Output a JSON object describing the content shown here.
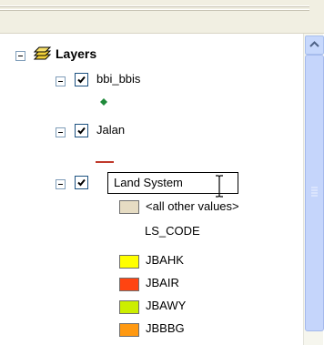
{
  "colors": {
    "point_symbol": "#1f8a3a",
    "line_symbol": "#c0392b",
    "all_other_values": "#e6dcc3",
    "JBAHK": "#ffff00",
    "JBAIR": "#ff4411",
    "JBAWY": "#ccee00",
    "JBBBG": "#ff9911"
  },
  "toc": {
    "root": {
      "label": "Layers",
      "icon": "layers-icon"
    },
    "layers": [
      {
        "label": "bbi_bbis",
        "checked": true,
        "symbol": "point"
      },
      {
        "label": "Jalan",
        "checked": true,
        "symbol": "line"
      },
      {
        "label": "Land System",
        "checked": true,
        "editing": true
      }
    ],
    "legend": {
      "other_values": "<all other values>",
      "field": "LS_CODE",
      "classes": [
        "JBAHK",
        "JBAIR",
        "JBAWY",
        "JBBBG"
      ]
    }
  },
  "cursor": "text-cursor"
}
